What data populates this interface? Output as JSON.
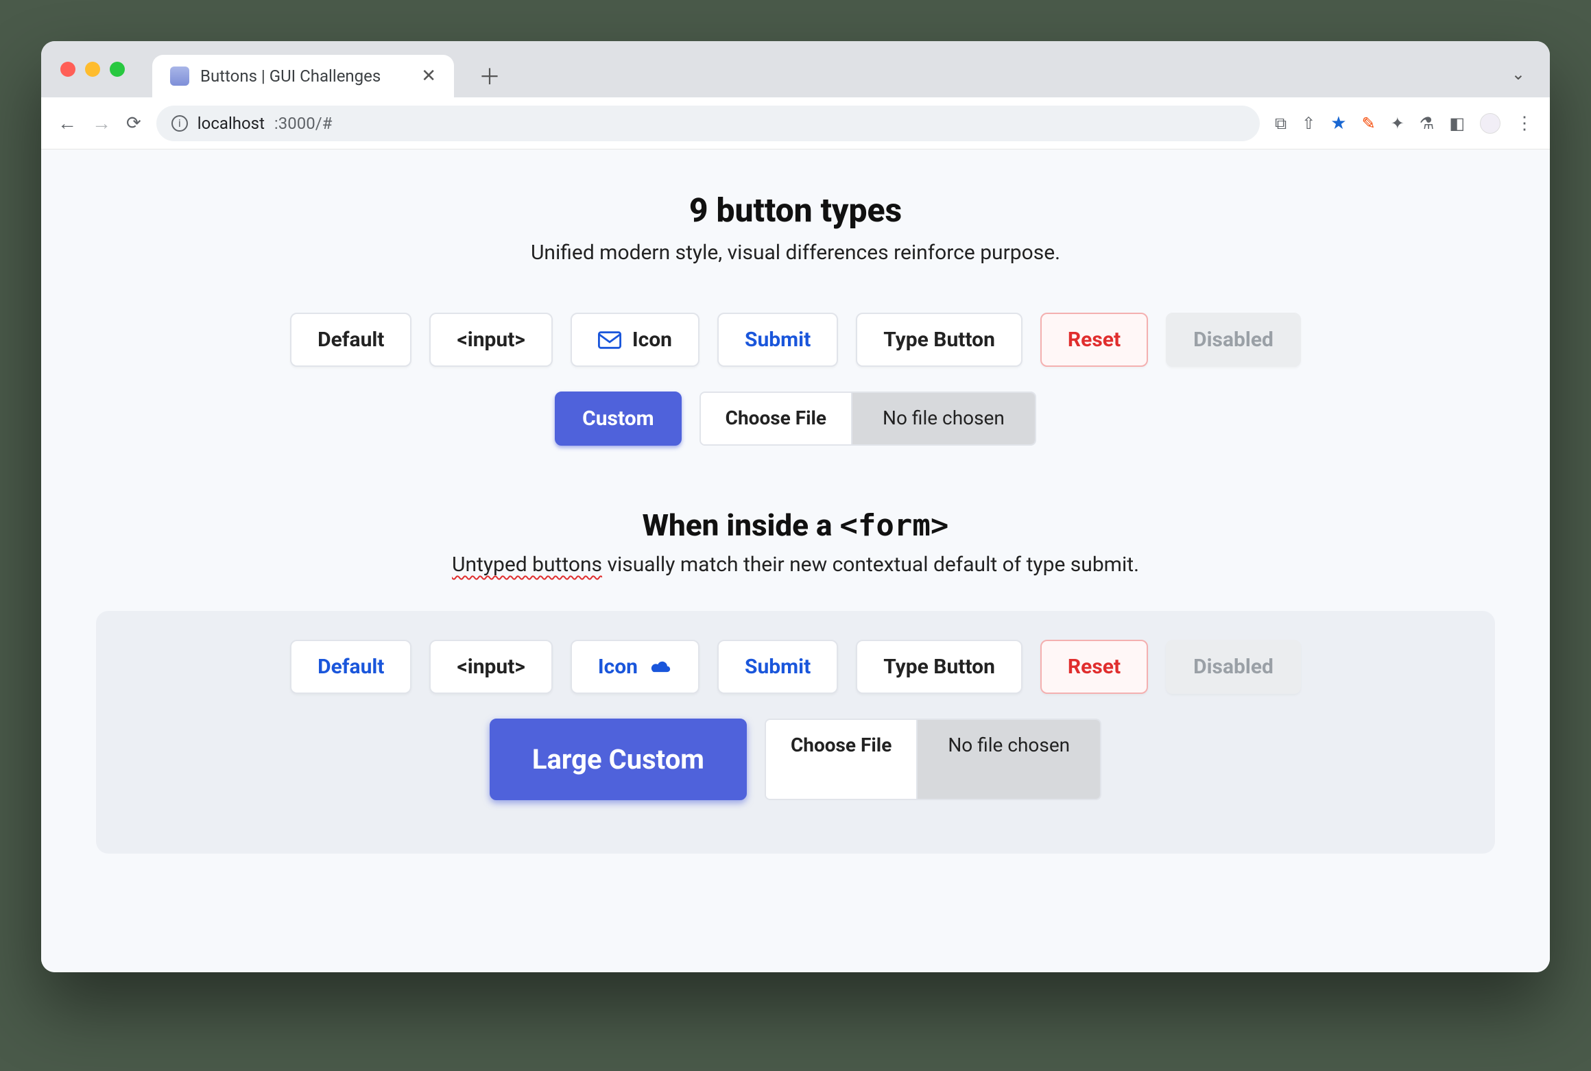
{
  "browser": {
    "tab_title": "Buttons | GUI Challenges",
    "url_host": "localhost",
    "url_rest": ":3000/#"
  },
  "section1": {
    "title": "9 button types",
    "subtitle": "Unified modern style, visual differences reinforce purpose."
  },
  "row1": {
    "default": "Default",
    "input": "<input>",
    "icon": "Icon",
    "submit": "Submit",
    "type_button": "Type Button",
    "reset": "Reset",
    "disabled": "Disabled"
  },
  "row1b": {
    "custom": "Custom",
    "choose_file": "Choose File",
    "file_status": "No file chosen"
  },
  "section2": {
    "title_pre": "When inside a ",
    "title_code": "<form>",
    "sub_u": "Untyped buttons",
    "sub_rest": " visually match their new contextual default of type submit."
  },
  "row2": {
    "default": "Default",
    "input": "<input>",
    "icon": "Icon",
    "submit": "Submit",
    "type_button": "Type Button",
    "reset": "Reset",
    "disabled": "Disabled"
  },
  "row2b": {
    "large_custom": "Large Custom",
    "choose_file": "Choose File",
    "file_status": "No file chosen"
  }
}
